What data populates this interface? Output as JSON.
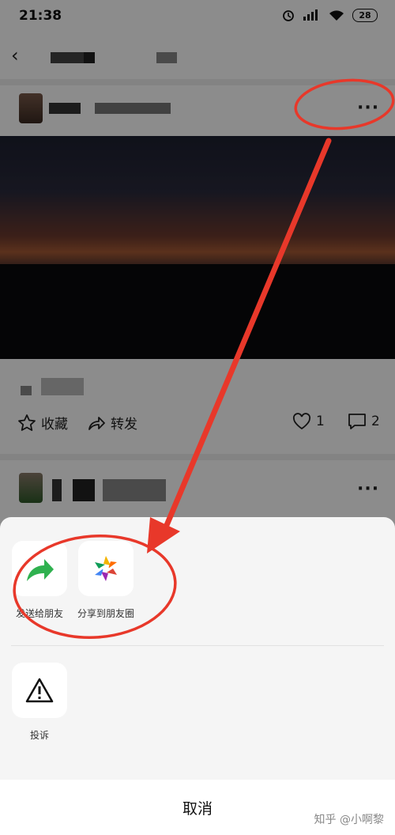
{
  "status_bar": {
    "time": "21:38",
    "battery": "28"
  },
  "post": {
    "actions": {
      "favorite_label": "收藏",
      "forward_label": "转发",
      "like_count": "1",
      "comment_count": "2"
    }
  },
  "share_sheet": {
    "items": [
      {
        "label": "发送给朋友",
        "icon": "share-arrow-icon"
      },
      {
        "label": "分享到朋友圈",
        "icon": "moments-aperture-icon"
      }
    ],
    "secondary_items": [
      {
        "label": "投诉",
        "icon": "warning-icon"
      }
    ],
    "cancel_label": "取消"
  },
  "watermark": "知乎 @小啊黎",
  "colors": {
    "annotation_red": "#e8382a",
    "share_green": "#2fb14f"
  }
}
